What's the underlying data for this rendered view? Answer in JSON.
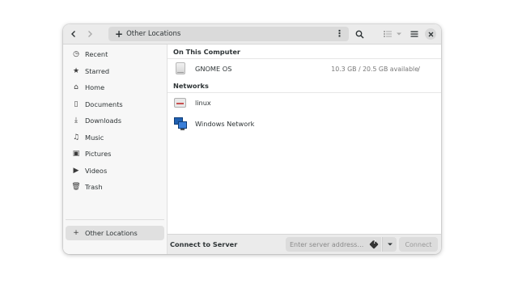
{
  "headerbar": {
    "location_label": "Other Locations",
    "back_icon": "chevron-left-icon",
    "forward_icon": "chevron-right-icon",
    "search_icon": "search-icon",
    "view_icon": "list-view-icon",
    "menu_icon": "hamburger-menu-icon",
    "close_icon": "close-icon"
  },
  "sidebar": {
    "items": [
      {
        "label": "Recent",
        "icon": "clock-icon",
        "glyph": "◷"
      },
      {
        "label": "Starred",
        "icon": "star-icon",
        "glyph": "★"
      },
      {
        "label": "Home",
        "icon": "home-icon",
        "glyph": "⌂"
      },
      {
        "label": "Documents",
        "icon": "document-icon",
        "glyph": "▯"
      },
      {
        "label": "Downloads",
        "icon": "download-icon",
        "glyph": "⤓"
      },
      {
        "label": "Music",
        "icon": "music-icon",
        "glyph": "♫"
      },
      {
        "label": "Pictures",
        "icon": "picture-icon",
        "glyph": "▣"
      },
      {
        "label": "Videos",
        "icon": "video-icon",
        "glyph": "▶"
      },
      {
        "label": "Trash",
        "icon": "trash-icon",
        "glyph": "🗑"
      }
    ],
    "other_locations": {
      "label": "Other Locations",
      "icon": "plus-icon",
      "glyph": "+"
    }
  },
  "main": {
    "on_this_computer": {
      "title": "On This Computer",
      "items": [
        {
          "name": "GNOME OS",
          "usage": "10.3 GB / 20.5 GB available",
          "mount": "/"
        }
      ]
    },
    "networks": {
      "title": "Networks",
      "items": [
        {
          "name": "linux"
        },
        {
          "name": "Windows Network"
        }
      ]
    }
  },
  "bottombar": {
    "title": "Connect to Server",
    "input_placeholder": "Enter server address…",
    "input_value": "",
    "connect_label": "Connect"
  }
}
